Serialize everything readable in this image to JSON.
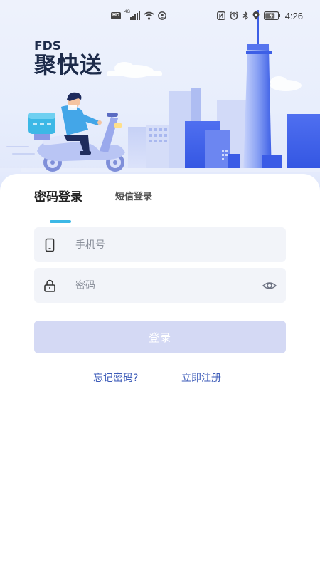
{
  "status_bar": {
    "left_badge": "HD",
    "network": "4G",
    "time": "4:26",
    "battery_icon": "battery-charging-icon",
    "icons": [
      "nfc-icon",
      "alarm-icon",
      "bluetooth-icon",
      "location-icon"
    ]
  },
  "brand": {
    "logo_top": "FDS",
    "logo_main": "聚快送"
  },
  "tabs": {
    "active": "密码登录",
    "inactive": "短信登录"
  },
  "form": {
    "phone_placeholder": "手机号",
    "phone_value": "",
    "phone_icon": "phone-icon",
    "password_placeholder": "密码",
    "password_value": "",
    "password_icon": "lock-icon",
    "toggle_icon": "eye-icon",
    "submit_label": "登录"
  },
  "links": {
    "forgot": "忘记密码?",
    "register": "立即注册"
  },
  "colors": {
    "accent": "#3cb8e6",
    "link": "#3c5bb8",
    "button_disabled": "#d4d9f4",
    "field_bg": "#f2f4f9"
  }
}
